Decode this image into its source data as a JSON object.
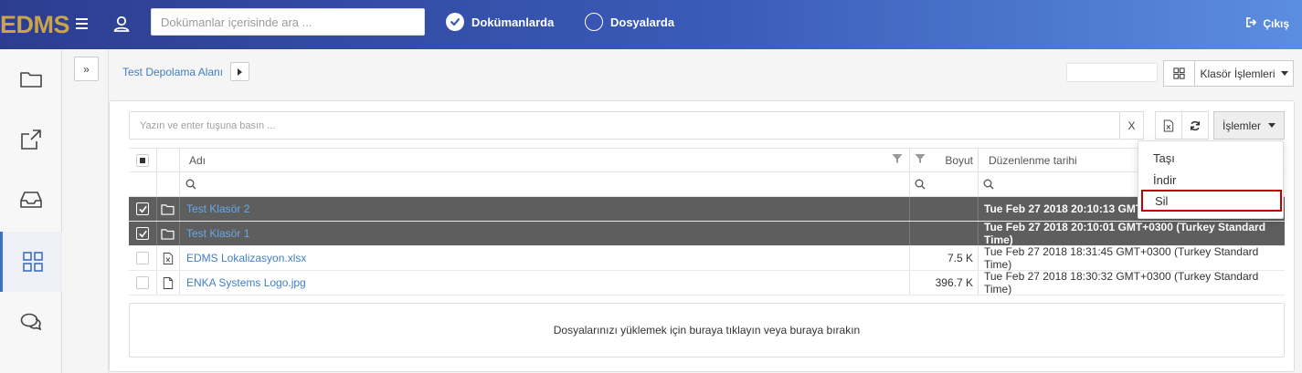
{
  "app": {
    "logo": "EDMS"
  },
  "header": {
    "search_placeholder": "Dokümanlar içerisinde ara ...",
    "radio_docs_label": "Dokümanlarda",
    "radio_folders_label": "Dosyalarda",
    "logout_label": "Çıkış"
  },
  "breadcrumb": {
    "current": "Test Depolama Alanı"
  },
  "toolbar": {
    "folder_ops_label": "Klasör İşlemleri"
  },
  "list": {
    "filter_placeholder": "Yazın ve enter tuşuna basın ...",
    "clear_label": "X",
    "ops_label": "İşlemler",
    "columns": {
      "name": "Adı",
      "size": "Boyut",
      "modified": "Düzenlenme tarihi"
    },
    "rows": [
      {
        "name": "Test Klasör 2",
        "size": "",
        "modified": "Tue Feb 27 2018 20:10:13 GMT+",
        "type": "folder",
        "selected": true
      },
      {
        "name": "Test Klasör 1",
        "size": "",
        "modified": "Tue Feb 27 2018 20:10:01 GMT+0300 (Turkey Standard Time)",
        "type": "folder",
        "selected": true
      },
      {
        "name": "EDMS Lokalizasyon.xlsx",
        "size": "7.5 K",
        "modified": "Tue Feb 27 2018 18:31:45 GMT+0300 (Turkey Standard Time)",
        "type": "excel",
        "selected": false
      },
      {
        "name": "ENKA Systems Logo.jpg",
        "size": "396.7 K",
        "modified": "Tue Feb 27 2018 18:30:32 GMT+0300 (Turkey Standard Time)",
        "type": "file",
        "selected": false
      }
    ],
    "dropzone_text": "Dosyalarınızı yüklemek için buraya tıklayın veya buraya bırakın"
  },
  "ops_menu": {
    "items": [
      "Taşı",
      "İndir",
      "Sil"
    ]
  },
  "colors": {
    "accent": "#3f7fc6",
    "selected_row": "#5e5e5e",
    "highlight": "#c00000",
    "logo": "#c9a44a"
  }
}
